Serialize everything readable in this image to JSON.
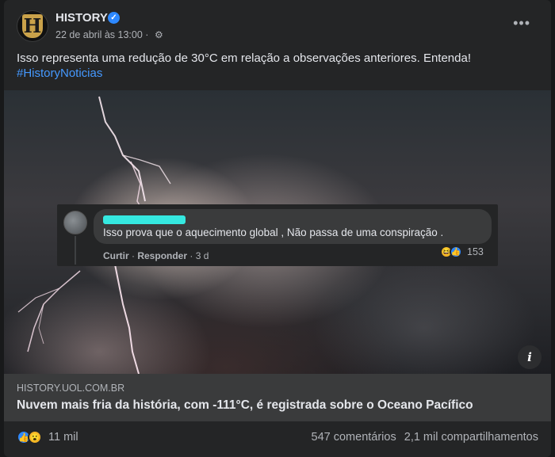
{
  "post": {
    "page_name": "HISTORY",
    "avatar_letter": "H",
    "timestamp": "22 de abril às 13:00 ·",
    "text": "Isso representa uma redução de 30°C em relação a observações anteriores. Entenda!",
    "hashtag": "#HistoryNoticias",
    "more_label": "•••"
  },
  "comment": {
    "text": "Isso prova que o aquecimento global , Não passa de uma conspiração .",
    "like_label": "Curtir",
    "separator": " · ",
    "reply_label": "Responder",
    "age": " · 3 d",
    "reaction_count": "153"
  },
  "link": {
    "domain": "HISTORY.UOL.COM.BR",
    "title": "Nuvem mais fria da história, com -111°C, é registrada sobre o Oceano Pacífico"
  },
  "footer": {
    "reactions_count": "11 mil",
    "comments": "547 comentários",
    "shares": "2,1 mil compartilhamentos"
  },
  "icons": {
    "verified": "verified-badge-icon",
    "audience": "gear-icon",
    "info": "info-icon"
  },
  "colors": {
    "background": "#242526",
    "accent": "#2d88ff",
    "hashtag": "#4599ff",
    "redaction": "#35e8e0"
  }
}
